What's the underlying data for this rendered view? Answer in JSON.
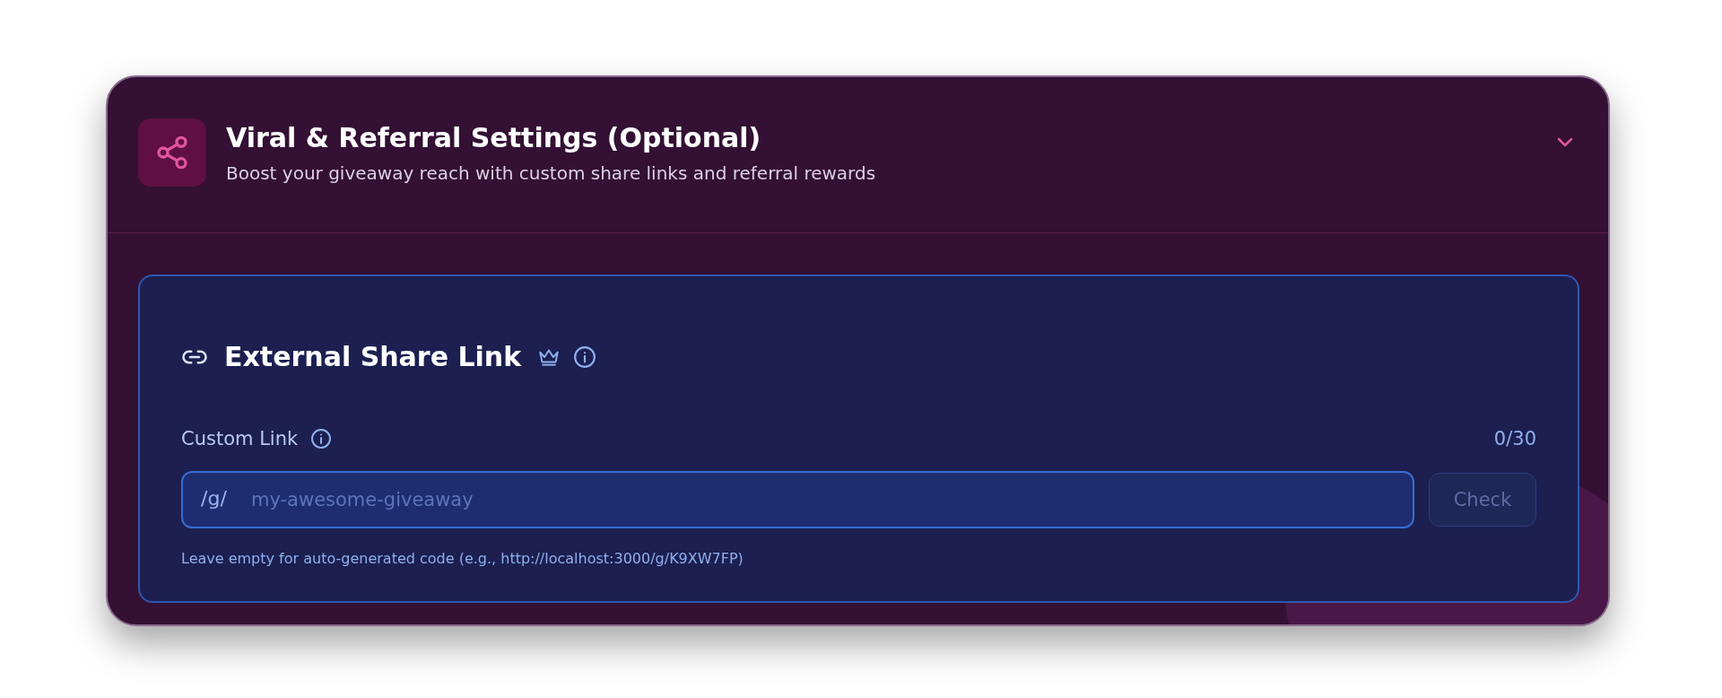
{
  "section": {
    "title": "Viral & Referral Settings (Optional)",
    "subtitle": "Boost your giveaway reach with custom share links and referral rewards"
  },
  "share_link": {
    "title": "External Share Link",
    "field_label": "Custom Link",
    "counter": "0/30",
    "prefix": "/g/",
    "placeholder": "my-awesome-giveaway",
    "check_button": {
      "label": "Check",
      "disabled": true
    },
    "hint": "Leave empty for auto-generated code (e.g., http://localhost:3000/g/K9XW7FP)"
  }
}
